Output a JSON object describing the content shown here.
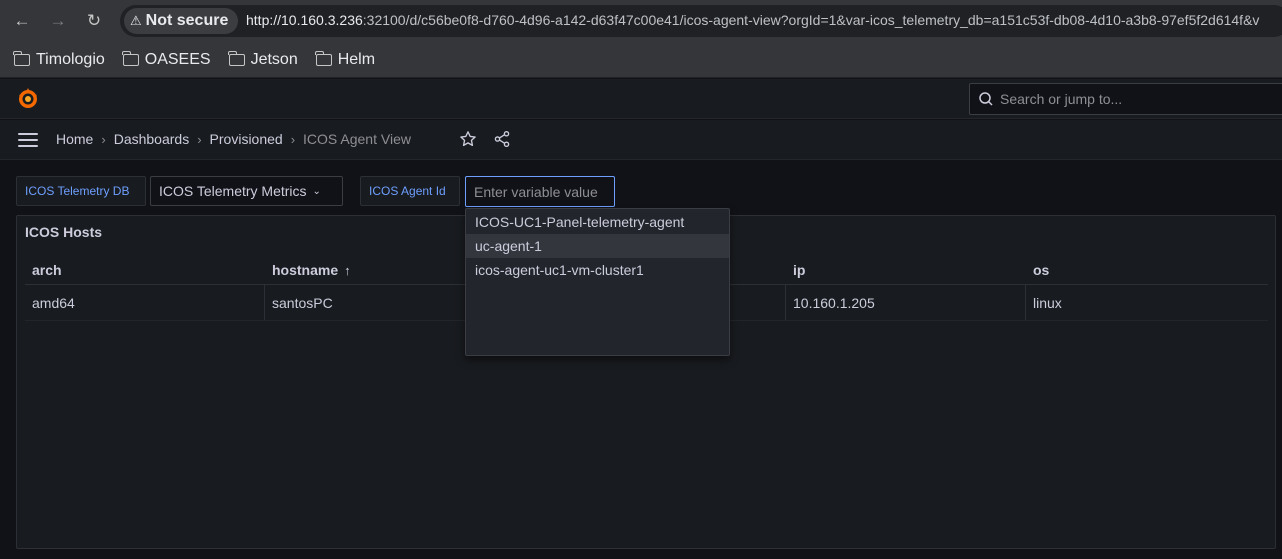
{
  "browser": {
    "security_label": "Not secure",
    "url_host": "http://10.160.3.236",
    "url_rest": ":32100/d/c56be0f8-d760-4d96-a142-d63f47c00e41/icos-agent-view?orgId=1&var-icos_telemetry_db=a151c53f-db08-4d10-a3b8-97ef5f2d614f&v",
    "bookmarks": [
      {
        "label": "Timologio"
      },
      {
        "label": "OASEES"
      },
      {
        "label": "Jetson"
      },
      {
        "label": "Helm"
      }
    ]
  },
  "topbar": {
    "search_placeholder": "Search or jump to..."
  },
  "breadcrumb": {
    "items": [
      "Home",
      "Dashboards",
      "Provisioned"
    ],
    "current": "ICOS Agent View"
  },
  "variables": {
    "db_label": "ICOS Telemetry DB",
    "db_value": "ICOS Telemetry Metrics",
    "agent_label": "ICOS Agent Id",
    "agent_placeholder": "Enter variable value"
  },
  "dropdown": {
    "options": [
      "ICOS-UC1-Panel-telemetry-agent",
      "uc-agent-1",
      "icos-agent-uc1-vm-cluster1"
    ]
  },
  "panel": {
    "title": "ICOS Hosts",
    "columns": [
      "arch",
      "hostname",
      "",
      "ip",
      "os"
    ],
    "rows": [
      [
        "amd64",
        "santosPC",
        "",
        "10.160.1.205",
        "linux"
      ]
    ]
  },
  "colors": {
    "accent": "#6e9fff",
    "background": "#111217",
    "panel": "#181b1f"
  }
}
